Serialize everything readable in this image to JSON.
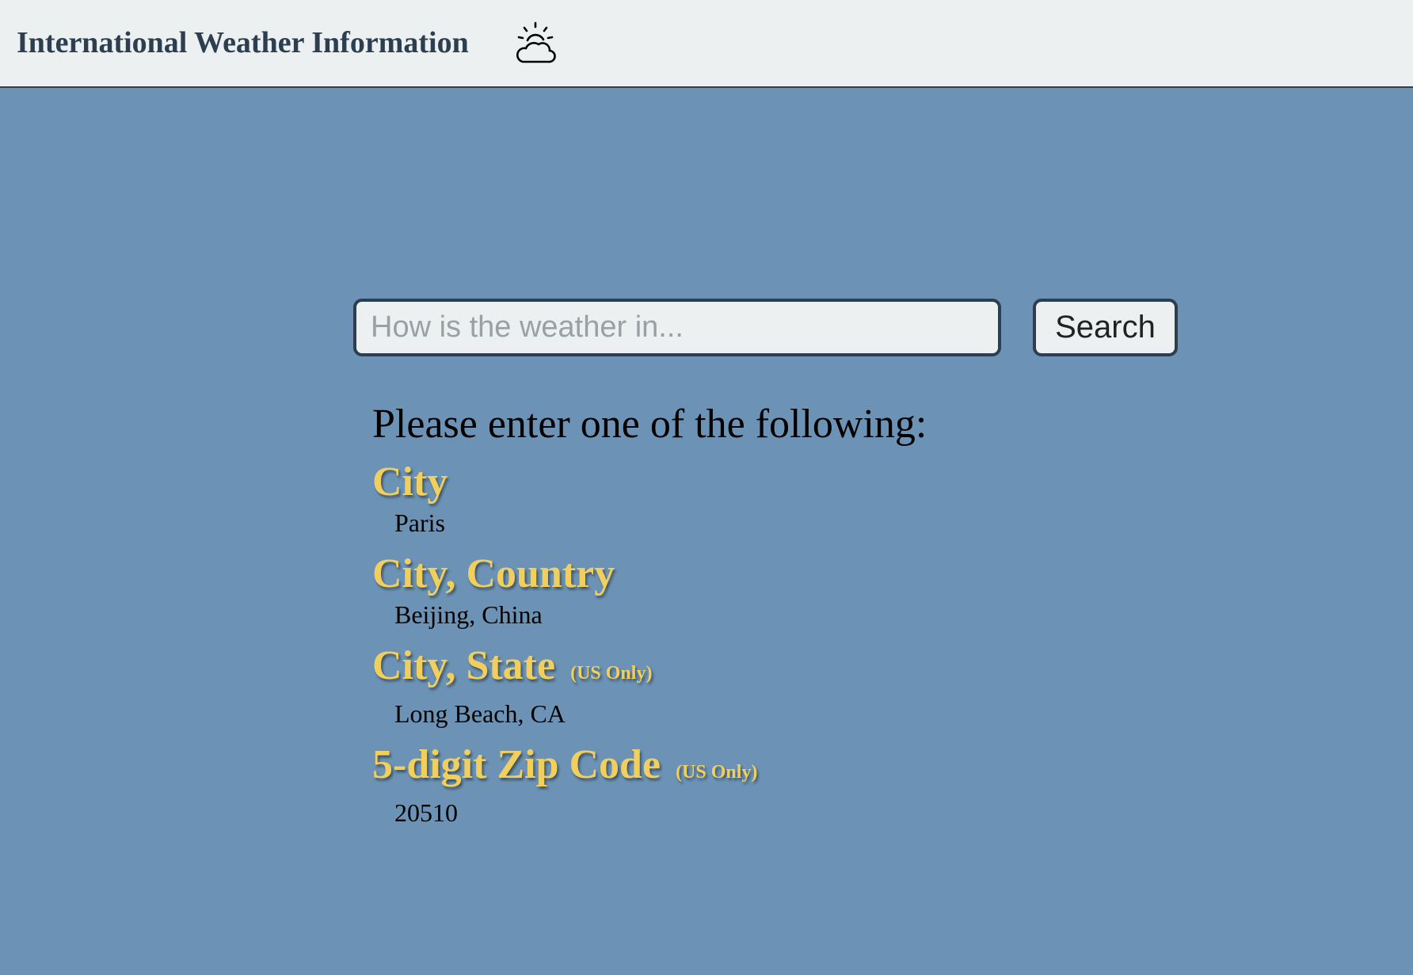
{
  "navbar": {
    "title": "International Weather Information",
    "icon": "partly-cloudy-icon"
  },
  "search": {
    "placeholder": "How is the weather in...",
    "value": "",
    "button_label": "Search"
  },
  "instructions": {
    "intro": "Please enter one of the following:",
    "formats": [
      {
        "title": "City",
        "note": "",
        "example": "Paris"
      },
      {
        "title": "City, Country",
        "note": "",
        "example": "Beijing, China"
      },
      {
        "title": "City, State",
        "note": "(US Only)",
        "example": "Long Beach, CA"
      },
      {
        "title": "5-digit Zip Code",
        "note": "(US Only)",
        "example": "20510"
      }
    ]
  },
  "colors": {
    "background": "#6c93b5",
    "navbar": "#ecf0f1",
    "navbar_text": "#2c3e50",
    "format_title": "#f0cf5e"
  }
}
